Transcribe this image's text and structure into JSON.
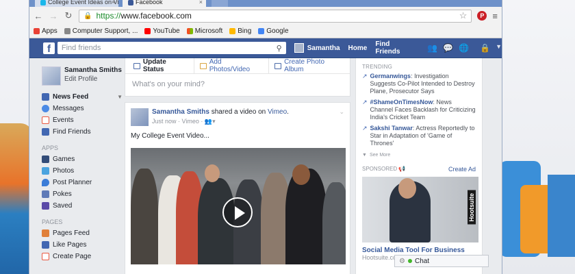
{
  "browser": {
    "tabs": [
      {
        "title": "College Event Ideas on Vi",
        "active": false
      },
      {
        "title": "Facebook",
        "active": true
      }
    ],
    "url_scheme": "https://",
    "url_rest": "www.facebook.com",
    "bookmarks": [
      {
        "label": "Apps",
        "icon": "apps-icon",
        "color": "#e94235"
      },
      {
        "label": "Computer Support, ...",
        "icon": "iyogi-icon",
        "color": "#888888"
      },
      {
        "label": "YouTube",
        "icon": "youtube-icon",
        "color": "#ff0000"
      },
      {
        "label": "Microsoft",
        "icon": "microsoft-icon",
        "color": "#f25022"
      },
      {
        "label": "Bing",
        "icon": "bing-icon",
        "color": "#ffb900"
      },
      {
        "label": "Google",
        "icon": "google-icon",
        "color": "#4285f4"
      }
    ]
  },
  "fb_header": {
    "search_placeholder": "Find friends",
    "user_name": "Samantha",
    "home": "Home",
    "find_friends": "Find Friends"
  },
  "sidebar": {
    "profile_name": "Samantha Smiths",
    "edit_profile": "Edit Profile",
    "favorites": [
      {
        "label": "News Feed",
        "icon": "news-feed-icon",
        "color": "#4267b2",
        "active": true
      },
      {
        "label": "Messages",
        "icon": "messages-icon",
        "color": "#4b8ae5",
        "active": false
      },
      {
        "label": "Events",
        "icon": "events-icon",
        "color": "#e9573f",
        "active": false
      },
      {
        "label": "Find Friends",
        "icon": "find-friends-icon",
        "color": "#4267b2",
        "active": false
      }
    ],
    "apps_heading": "APPS",
    "apps": [
      {
        "label": "Games",
        "icon": "games-icon",
        "color": "#324c78"
      },
      {
        "label": "Photos",
        "icon": "photos-icon",
        "color": "#4aa3df"
      },
      {
        "label": "Post Planner",
        "icon": "post-planner-icon",
        "color": "#3b7dd8"
      },
      {
        "label": "Pokes",
        "icon": "pokes-icon",
        "color": "#5f7ab8"
      },
      {
        "label": "Saved",
        "icon": "saved-icon",
        "color": "#5b4aa8"
      }
    ],
    "pages_heading": "PAGES",
    "pages": [
      {
        "label": "Pages Feed",
        "icon": "pages-feed-icon",
        "color": "#e0803a"
      },
      {
        "label": "Like Pages",
        "icon": "like-pages-icon",
        "color": "#4267b2"
      },
      {
        "label": "Create Page",
        "icon": "create-page-icon",
        "color": "#e9573f"
      }
    ]
  },
  "composer": {
    "tabs": [
      "Update Status",
      "Add Photos/Video",
      "Create Photo Album"
    ],
    "placeholder": "What's on your mind?"
  },
  "post": {
    "author": "Samantha Smiths",
    "action": "shared a video on",
    "via": "Vimeo",
    "period": ".",
    "meta": "Just now · Vimeo ·",
    "text": "My College Event Video..."
  },
  "trending": {
    "heading": "TRENDING",
    "items": [
      {
        "topic": "Germanwings",
        "text": ": Investigation Suggests Co-Pilot Intended to Destroy Plane, Prosecutor Says"
      },
      {
        "topic": "#ShameOnTimesNow",
        "text": ": News Channel Faces Backlash for Criticizing India's Cricket Team"
      },
      {
        "topic": "Sakshi Tanwar",
        "text": ": Actress Reportedly to Star in Adaptation of 'Game of Thrones'"
      }
    ],
    "see_more": "See More"
  },
  "sponsored": {
    "heading": "SPONSORED",
    "create_ad": "Create Ad",
    "ad_brand": "Hootsuite",
    "ad_title": "Social Media Tool For Business",
    "ad_url": "Hootsuite.com"
  },
  "chat": {
    "label": "Chat"
  }
}
